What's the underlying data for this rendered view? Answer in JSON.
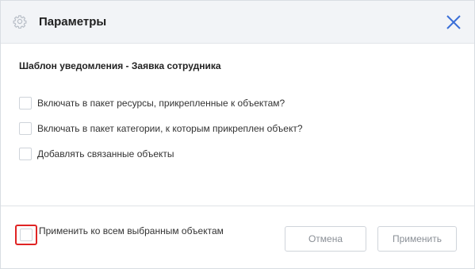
{
  "dialog": {
    "title": "Параметры",
    "subtitle": "Шаблон уведомления - Заявка сотрудника"
  },
  "options": [
    {
      "label": "Включать в пакет ресурсы, прикрепленные к объектам?",
      "checked": false
    },
    {
      "label": "Включать в пакет категории, к которым прикреплен объект?",
      "checked": false
    },
    {
      "label": "Добавлять связанные объекты",
      "checked": false
    }
  ],
  "footer": {
    "apply_all_label": "Применить ко всем выбранным объектам",
    "apply_all_checked": false,
    "cancel_label": "Отмена",
    "apply_label": "Применить"
  },
  "icons": {
    "header_icon": "gear-icon",
    "close_icon": "close-icon"
  },
  "colors": {
    "accent": "#3a6fd8",
    "highlight": "#e02424",
    "header_bg": "#f2f4f7"
  }
}
